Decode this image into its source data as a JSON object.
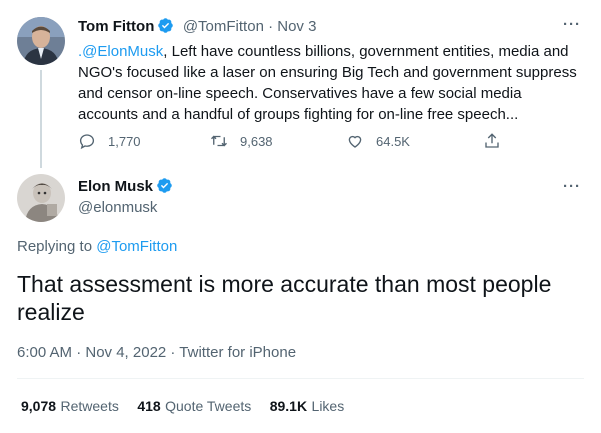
{
  "parent_tweet": {
    "author_name": "Tom Fitton",
    "handle_date": "@TomFitton · Nov 3",
    "mention": ".@ElonMusk",
    "text_rest": ", Left have countless billions, government entities, media and",
    "line2": "NGO's focused like a laser on ensuring Big Tech and government suppress",
    "line3": "and censor on-line speech. Conservatives have a few social media",
    "line4": "accounts and a handful of groups fighting for on-line free speech...",
    "replies": "1,770",
    "retweets": "9,638",
    "likes": "64.5K",
    "more": "···"
  },
  "main_tweet": {
    "author_name": "Elon Musk",
    "handle": "@elonmusk",
    "more": "···",
    "replying_prefix": "Replying to",
    "replying_handle": "@TomFitton",
    "text_line1": "That assessment is more accurate than most people",
    "text_line2": "realize",
    "meta": "6:00 AM · Nov 4, 2022 · Twitter for iPhone",
    "stats": {
      "retweets_count": "9,078",
      "retweets_label": "Retweets",
      "quotes_count": "418",
      "quotes_label": "Quote Tweets",
      "likes_count": "89.1K",
      "likes_label": "Likes"
    }
  },
  "colors": {
    "accent": "#1d9bf0",
    "text": "#0f1419",
    "muted": "#536471",
    "divider": "#eff3f4"
  }
}
